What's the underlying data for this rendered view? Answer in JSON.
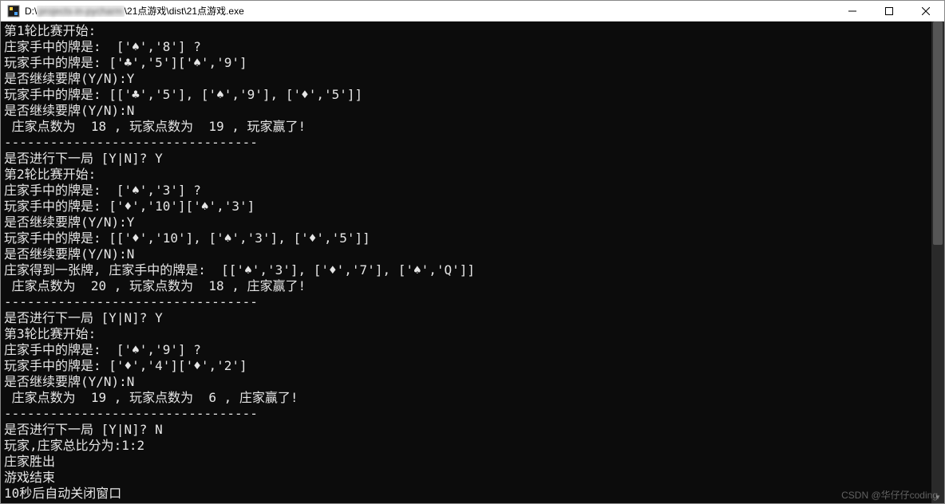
{
  "titlebar": {
    "path_prefix": "D:\\",
    "path_blur": "projects-in-pycharm",
    "title_suffix": "\\21点游戏\\dist\\21点游戏.exe"
  },
  "console": {
    "lines": [
      "第1轮比赛开始:",
      "庄家手中的牌是:  ['♠','8'] ?",
      "玩家手中的牌是: ['♣','5']['♠','9']",
      "是否继续要牌(Y/N):Y",
      "玩家手中的牌是: [['♣','5'], ['♠','9'], ['♦','5']]",
      "是否继续要牌(Y/N):N",
      " 庄家点数为  18 , 玩家点数为  19 , 玩家赢了!",
      "---------------------------------",
      "是否进行下一局 [Y|N]? Y",
      "第2轮比赛开始:",
      "庄家手中的牌是:  ['♠','3'] ?",
      "玩家手中的牌是: ['♦','10']['♠','3']",
      "是否继续要牌(Y/N):Y",
      "玩家手中的牌是: [['♦','10'], ['♠','3'], ['♦','5']]",
      "是否继续要牌(Y/N):N",
      "庄家得到一张牌, 庄家手中的牌是:  [['♠','3'], ['♦','7'], ['♠','Q']]",
      " 庄家点数为  20 , 玩家点数为  18 , 庄家赢了!",
      "---------------------------------",
      "是否进行下一局 [Y|N]? Y",
      "第3轮比赛开始:",
      "庄家手中的牌是:  ['♠','9'] ?",
      "玩家手中的牌是: ['♦','4']['♦','2']",
      "是否继续要牌(Y/N):N",
      " 庄家点数为  19 , 玩家点数为  6 , 庄家赢了!",
      "---------------------------------",
      "是否进行下一局 [Y|N]? N",
      "玩家,庄家总比分为:1:2",
      "庄家胜出",
      "游戏结束",
      "10秒后自动关闭窗口"
    ]
  },
  "watermark": "CSDN @华仔仔coding"
}
